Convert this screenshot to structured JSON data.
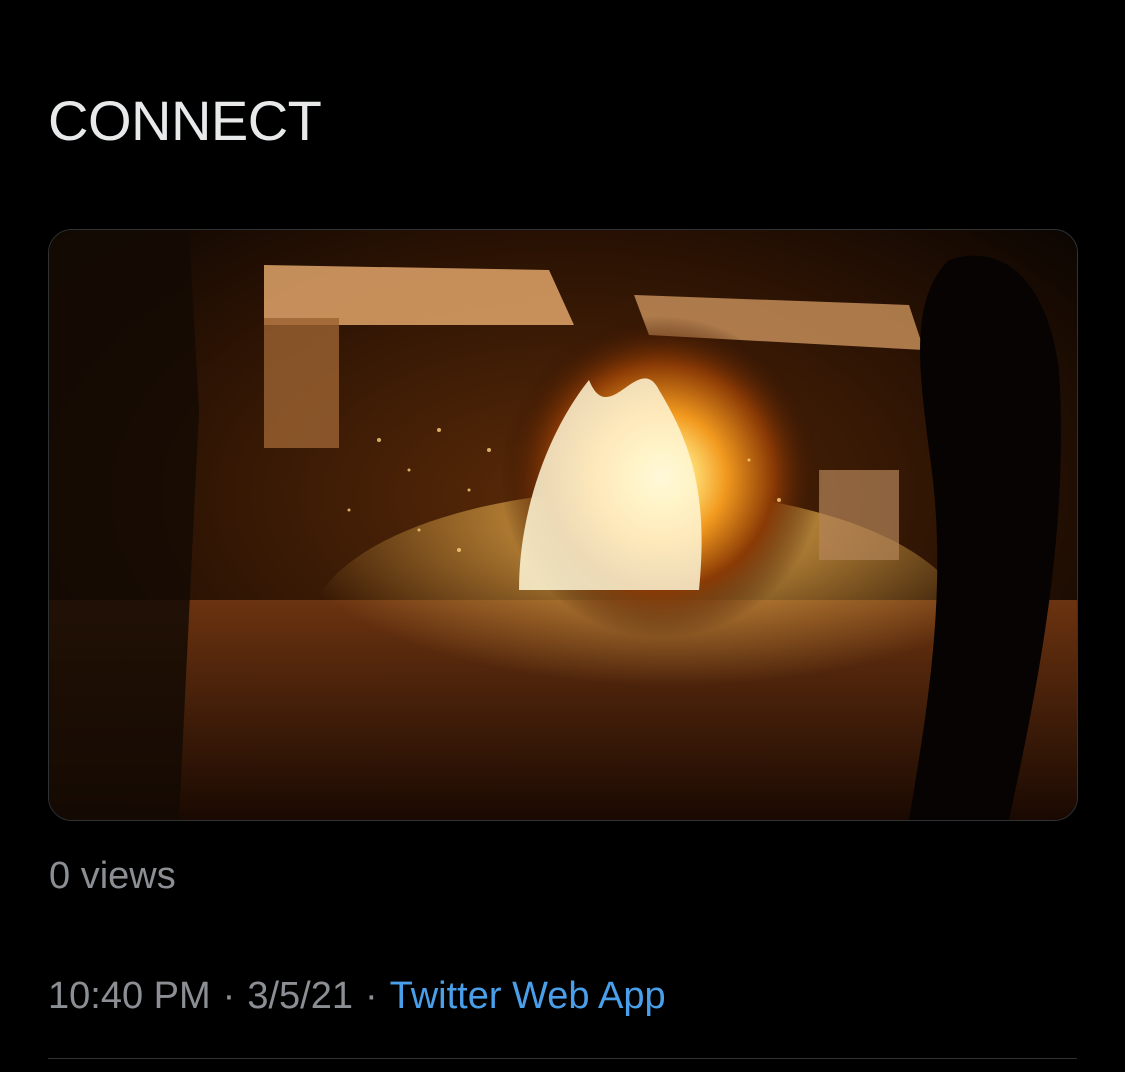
{
  "tweet": {
    "text": "CONNECT"
  },
  "media": {
    "type": "video",
    "icon": "video-thumbnail"
  },
  "stats": {
    "views": "0 views"
  },
  "meta": {
    "time": "10:40 PM",
    "separator": "·",
    "date": "3/5/21",
    "source": "Twitter Web App"
  },
  "colors": {
    "background": "#000000",
    "text": "#e7e9ea",
    "secondary_text": "#8b8f94",
    "link": "#4a9fea",
    "border": "#2f3336"
  }
}
